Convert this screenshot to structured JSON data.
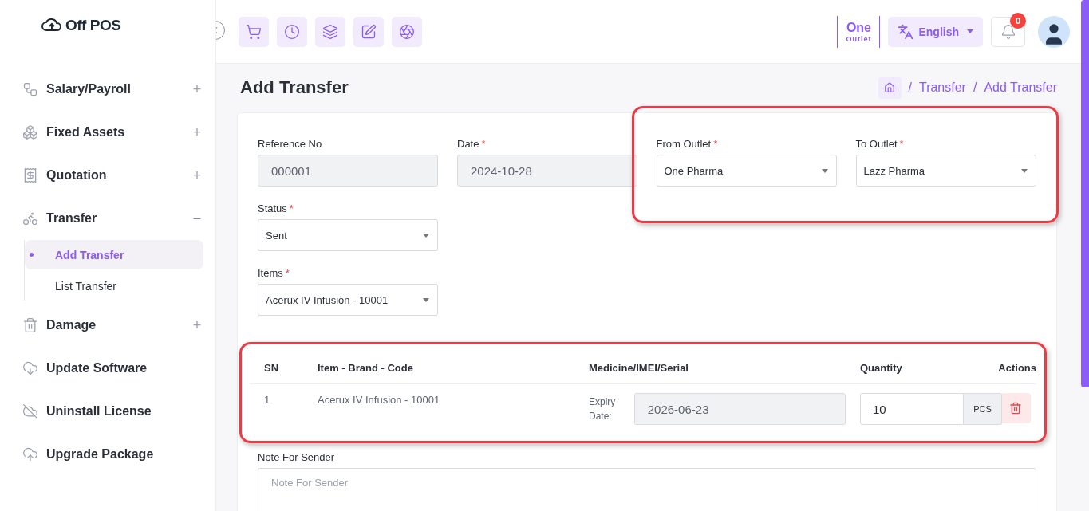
{
  "logo": {
    "text": "Off POS"
  },
  "sidebar": {
    "items": [
      {
        "label": "Salary/Payroll",
        "toggle": "+",
        "expanded": false
      },
      {
        "label": "Fixed Assets",
        "toggle": "+",
        "expanded": false
      },
      {
        "label": "Quotation",
        "toggle": "+",
        "expanded": false
      },
      {
        "label": "Transfer",
        "toggle": "−",
        "expanded": true,
        "children": [
          {
            "label": "Add Transfer",
            "selected": true
          },
          {
            "label": "List Transfer",
            "selected": false
          }
        ]
      },
      {
        "label": "Damage",
        "toggle": "+",
        "expanded": false
      },
      {
        "label": "Update Software"
      },
      {
        "label": "Uninstall License"
      },
      {
        "label": "Upgrade Package"
      }
    ]
  },
  "header": {
    "outlet": {
      "name": "One",
      "caption": "Outlet"
    },
    "language": "English",
    "notification_count": "0"
  },
  "page": {
    "title": "Add Transfer",
    "breadcrumb": [
      {
        "separator": "/",
        "label": "Transfer"
      },
      {
        "separator": "/",
        "label": "Add Transfer"
      }
    ]
  },
  "form": {
    "fields": [
      {
        "kind": "input",
        "label": "Reference No",
        "value": "000001",
        "disabled": true
      },
      {
        "kind": "input",
        "label": "Date",
        "required_mark": "*",
        "value": "2024-10-28",
        "disabled": true
      },
      {
        "kind": "select",
        "label": "From Outlet",
        "required_mark": "*",
        "value": "One Pharma",
        "disabled": false
      },
      {
        "kind": "select",
        "label": "To Outlet",
        "required_mark": "*",
        "value": "Lazz Pharma",
        "disabled": false
      },
      {
        "kind": "select",
        "label": "Status",
        "required_mark": "*",
        "value": "Sent",
        "disabled": false
      },
      {
        "kind": "select",
        "label": "Items",
        "required_mark": "*",
        "value": "Acerux IV Infusion - 10001",
        "disabled": false
      }
    ]
  },
  "table": {
    "columns": [
      "SN",
      "Item - Brand - Code",
      "Medicine/IMEI/Serial",
      "Quantity",
      "Actions"
    ],
    "rows": [
      {
        "sn": "1",
        "item": "Acerux IV Infusion - 10001",
        "expiry_label": "Expiry Date:",
        "expiry": "2026-06-23",
        "quantity": "10",
        "unit": "PCS"
      }
    ]
  },
  "note": {
    "label": "Note For Sender",
    "placeholder": "Note For Sender"
  }
}
